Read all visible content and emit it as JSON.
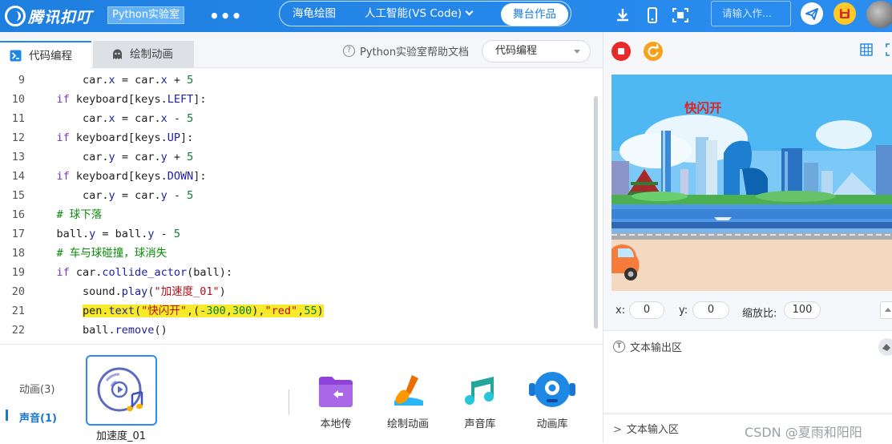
{
  "header": {
    "logo_text": "腾讯扣叮",
    "logo_tag": "Python实验室",
    "more_label": "•••",
    "modes": [
      {
        "label": "海龟绘图"
      },
      {
        "label": "人工智能(VS Code)"
      },
      {
        "label": "舞台作品"
      }
    ],
    "search_placeholder": "请输入作..."
  },
  "editor": {
    "tabs": [
      {
        "label": "代码编程"
      },
      {
        "label": "绘制动画"
      }
    ],
    "help_label": "Python实验室帮助文档",
    "mode_select": "代码编程",
    "lines": [
      {
        "n": "9",
        "tokens": [
          {
            "t": "        car.",
            "c": ""
          },
          {
            "t": "x",
            "c": "attr"
          },
          {
            "t": " = car.",
            "c": ""
          },
          {
            "t": "x",
            "c": "attr"
          },
          {
            "t": " + ",
            "c": ""
          },
          {
            "t": "5",
            "c": "num"
          }
        ]
      },
      {
        "n": "10",
        "tokens": [
          {
            "t": "    ",
            "c": ""
          },
          {
            "t": "if",
            "c": "kw"
          },
          {
            "t": " keyboard[keys.",
            "c": ""
          },
          {
            "t": "LEFT",
            "c": "attr"
          },
          {
            "t": "]:",
            "c": ""
          }
        ]
      },
      {
        "n": "11",
        "tokens": [
          {
            "t": "        car.",
            "c": ""
          },
          {
            "t": "x",
            "c": "attr"
          },
          {
            "t": " = car.",
            "c": ""
          },
          {
            "t": "x",
            "c": "attr"
          },
          {
            "t": " - ",
            "c": ""
          },
          {
            "t": "5",
            "c": "num"
          }
        ]
      },
      {
        "n": "12",
        "tokens": [
          {
            "t": "    ",
            "c": ""
          },
          {
            "t": "if",
            "c": "kw"
          },
          {
            "t": " keyboard[keys.",
            "c": ""
          },
          {
            "t": "UP",
            "c": "attr"
          },
          {
            "t": "]:",
            "c": ""
          }
        ]
      },
      {
        "n": "13",
        "tokens": [
          {
            "t": "        car.",
            "c": ""
          },
          {
            "t": "y",
            "c": "attr"
          },
          {
            "t": " = car.",
            "c": ""
          },
          {
            "t": "y",
            "c": "attr"
          },
          {
            "t": " + ",
            "c": ""
          },
          {
            "t": "5",
            "c": "num"
          }
        ]
      },
      {
        "n": "14",
        "tokens": [
          {
            "t": "    ",
            "c": ""
          },
          {
            "t": "if",
            "c": "kw"
          },
          {
            "t": " keyboard[keys.",
            "c": ""
          },
          {
            "t": "DOWN",
            "c": "attr"
          },
          {
            "t": "]:",
            "c": ""
          }
        ]
      },
      {
        "n": "15",
        "tokens": [
          {
            "t": "        car.",
            "c": ""
          },
          {
            "t": "y",
            "c": "attr"
          },
          {
            "t": " = car.",
            "c": ""
          },
          {
            "t": "y",
            "c": "attr"
          },
          {
            "t": " - ",
            "c": ""
          },
          {
            "t": "5",
            "c": "num"
          }
        ]
      },
      {
        "n": "16",
        "tokens": [
          {
            "t": "    ",
            "c": ""
          },
          {
            "t": "# 球下落",
            "c": "cmt"
          }
        ]
      },
      {
        "n": "17",
        "tokens": [
          {
            "t": "    ball.",
            "c": ""
          },
          {
            "t": "y",
            "c": "attr"
          },
          {
            "t": " = ball.",
            "c": ""
          },
          {
            "t": "y",
            "c": "attr"
          },
          {
            "t": " - ",
            "c": ""
          },
          {
            "t": "5",
            "c": "num"
          }
        ]
      },
      {
        "n": "18",
        "tokens": [
          {
            "t": "    ",
            "c": ""
          },
          {
            "t": "# 车与球碰撞，球消失",
            "c": "cmt"
          }
        ]
      },
      {
        "n": "19",
        "tokens": [
          {
            "t": "    ",
            "c": ""
          },
          {
            "t": "if",
            "c": "kw"
          },
          {
            "t": " car.",
            "c": ""
          },
          {
            "t": "collide_actor",
            "c": "attr"
          },
          {
            "t": "(ball):",
            "c": ""
          }
        ]
      },
      {
        "n": "20",
        "tokens": [
          {
            "t": "        sound.",
            "c": ""
          },
          {
            "t": "play",
            "c": "attr"
          },
          {
            "t": "(",
            "c": ""
          },
          {
            "t": "\"加速度_01\"",
            "c": "str"
          },
          {
            "t": ")",
            "c": ""
          }
        ]
      },
      {
        "n": "21",
        "highlight": true,
        "tokens": [
          {
            "t": "        ",
            "c": ""
          },
          {
            "t": "pen.",
            "c": "hl"
          },
          {
            "t": "text",
            "c": "hl attr"
          },
          {
            "t": "(",
            "c": "hl"
          },
          {
            "t": "\"快闪开\"",
            "c": "hl str"
          },
          {
            "t": ",(-",
            "c": "hl"
          },
          {
            "t": "300",
            "c": "hl num"
          },
          {
            "t": ",",
            "c": "hl"
          },
          {
            "t": "300",
            "c": "hl num"
          },
          {
            "t": "),",
            "c": "hl"
          },
          {
            "t": "\"red\"",
            "c": "hl str"
          },
          {
            "t": ",",
            "c": "hl"
          },
          {
            "t": "55",
            "c": "hl num"
          },
          {
            "t": ")",
            "c": "hl"
          }
        ]
      },
      {
        "n": "22",
        "tokens": [
          {
            "t": "        ball.",
            "c": ""
          },
          {
            "t": "remove",
            "c": "attr"
          },
          {
            "t": "()",
            "c": ""
          }
        ]
      }
    ]
  },
  "assets": {
    "side": [
      {
        "label": "动画(3)"
      },
      {
        "label": "声音(1)"
      }
    ],
    "sound_name": "加速度_01",
    "tools": [
      {
        "label": "本地传"
      },
      {
        "label": "绘制动画"
      },
      {
        "label": "声音库"
      },
      {
        "label": "动画库"
      }
    ]
  },
  "preview": {
    "stage_text": "快闪开",
    "stage_text_color": "#e22222",
    "x_label": "x:",
    "x_value": "0",
    "y_label": "y:",
    "y_value": "0",
    "zoom_label": "缩放比:",
    "zoom_value": "100",
    "output_label": "文本输出区",
    "input_label": "文本输入区",
    "watermark": "CSDN @夏雨和阳阳"
  },
  "colors": {
    "brand": "#1f7fe0",
    "highlight": "#f6ea2a",
    "keyword": "#7a2fbf",
    "number": "#0b7a3a",
    "string": "#b5101a",
    "comment": "#0a8a0a"
  }
}
